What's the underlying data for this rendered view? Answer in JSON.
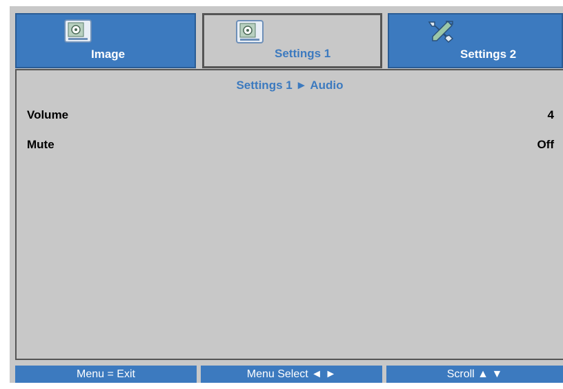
{
  "tabs": [
    {
      "label": "Image",
      "icon": "image-settings-icon",
      "active": false
    },
    {
      "label": "Settings 1",
      "icon": "settings-document-icon",
      "active": true
    },
    {
      "label": "Settings 2",
      "icon": "tools-icon",
      "active": false
    }
  ],
  "breadcrumb": "Settings 1 ► Audio",
  "rows": [
    {
      "label": "Volume",
      "value": "4"
    },
    {
      "label": "Mute",
      "value": "Off"
    }
  ],
  "bottom_bar": [
    "Menu = Exit",
    "Menu Select ◄ ►",
    "Scroll ▲ ▼"
  ],
  "colors": {
    "accent_blue": "#3c7abf",
    "panel_gray": "#c8c8c8",
    "border_dark": "#555555"
  }
}
